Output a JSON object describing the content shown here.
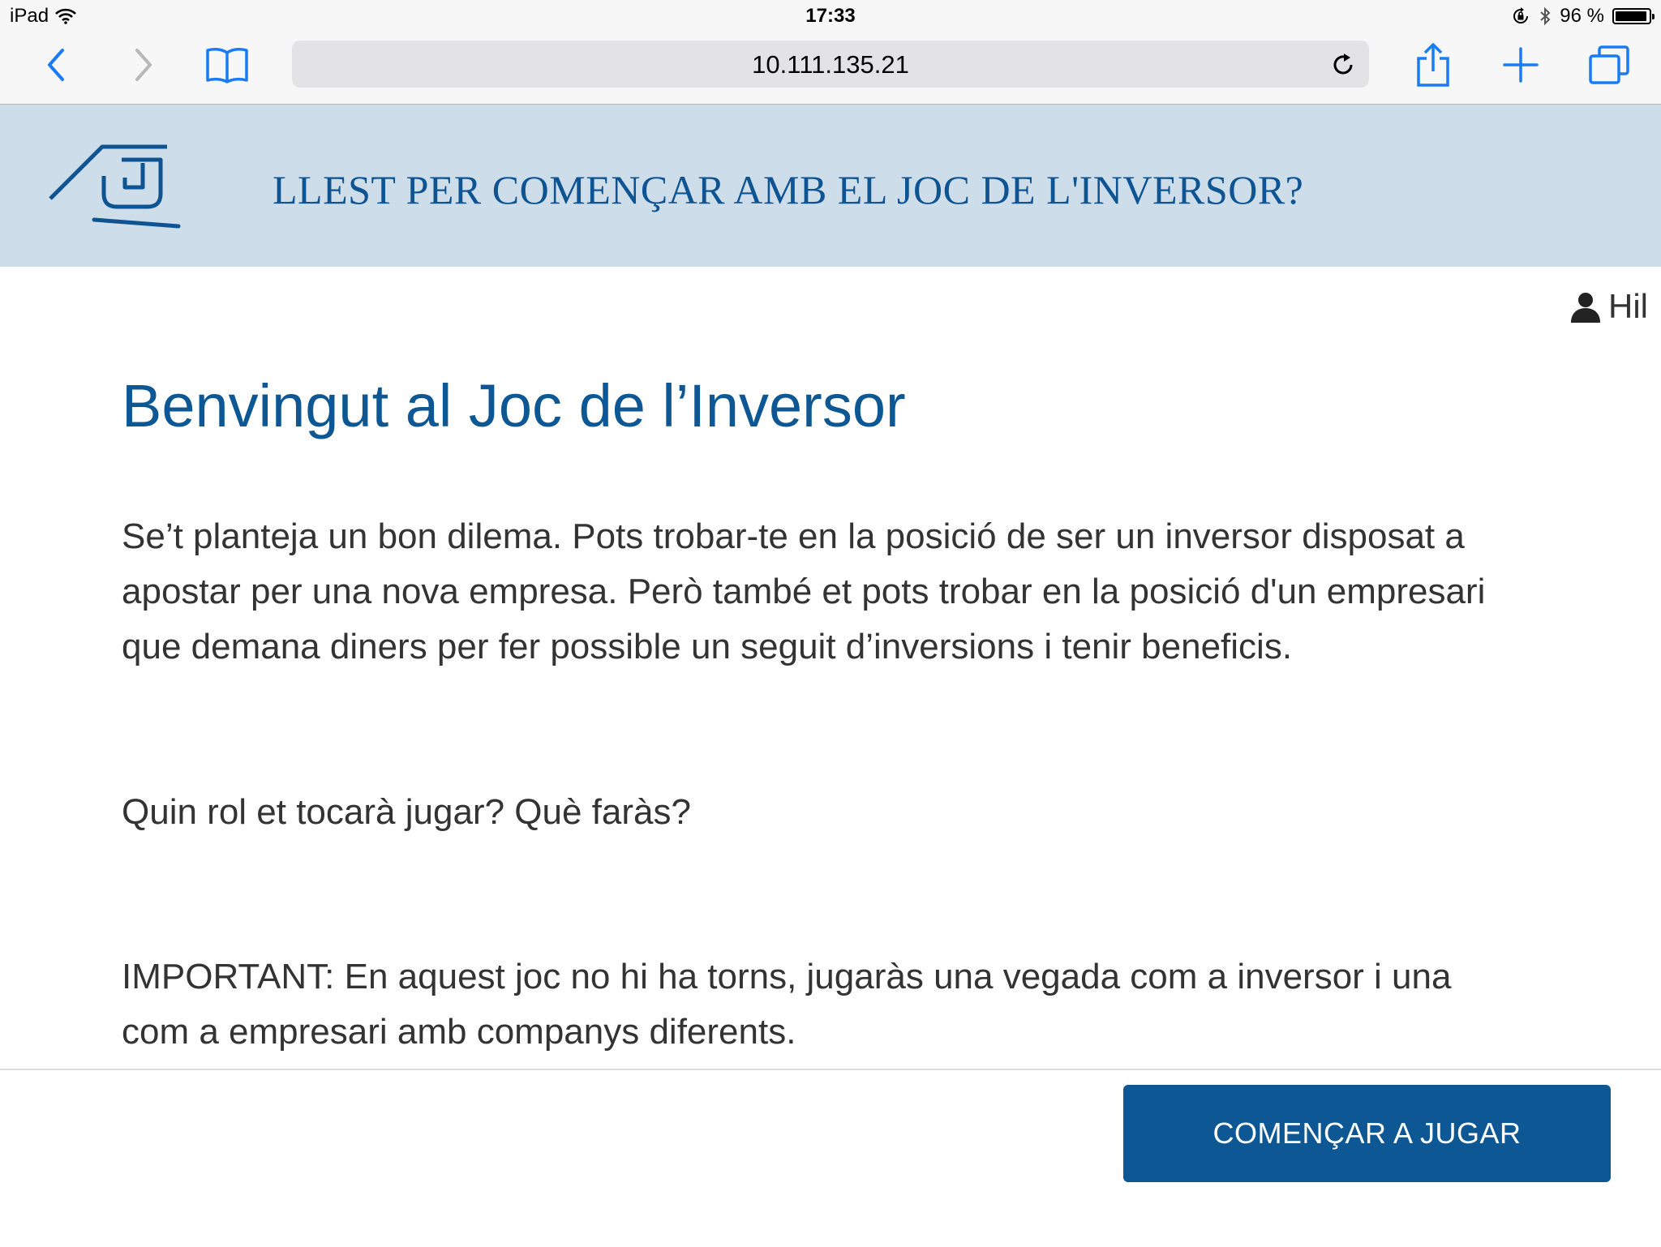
{
  "status_bar": {
    "device": "iPad",
    "time": "17:33",
    "battery": "96 %",
    "battery_level": 0.96
  },
  "browser": {
    "url": "10.111.135.21",
    "icons": [
      "back-icon",
      "forward-icon",
      "bookmarks-icon",
      "reload-icon",
      "share-icon",
      "new-tab-icon",
      "tabs-icon"
    ]
  },
  "banner": {
    "title": "LLEST PER COMENÇAR AMB EL JOC DE L'INVERSOR?",
    "background": "#cddde9",
    "title_color": "#0f5492"
  },
  "user": {
    "name": "Hil"
  },
  "main": {
    "heading": "Benvingut al Joc de l’Inversor",
    "paragraph1": "Se’t planteja un bon dilema. Pots trobar-te en la posició de ser un inversor disposat a apostar per una nova empresa. Però també et pots trobar en la posició d'un empresari que demana diners per fer possible un seguit d’inversions i tenir beneficis.",
    "paragraph2": "Quin rol et tocarà jugar? Què faràs?",
    "paragraph3": "IMPORTANT: En aquest joc no hi ha torns, jugaràs una vegada com a inversor i una com a empresari amb companys diferents."
  },
  "footer": {
    "start_button": "COMENÇAR A JUGAR",
    "button_color": "#0d5894"
  }
}
